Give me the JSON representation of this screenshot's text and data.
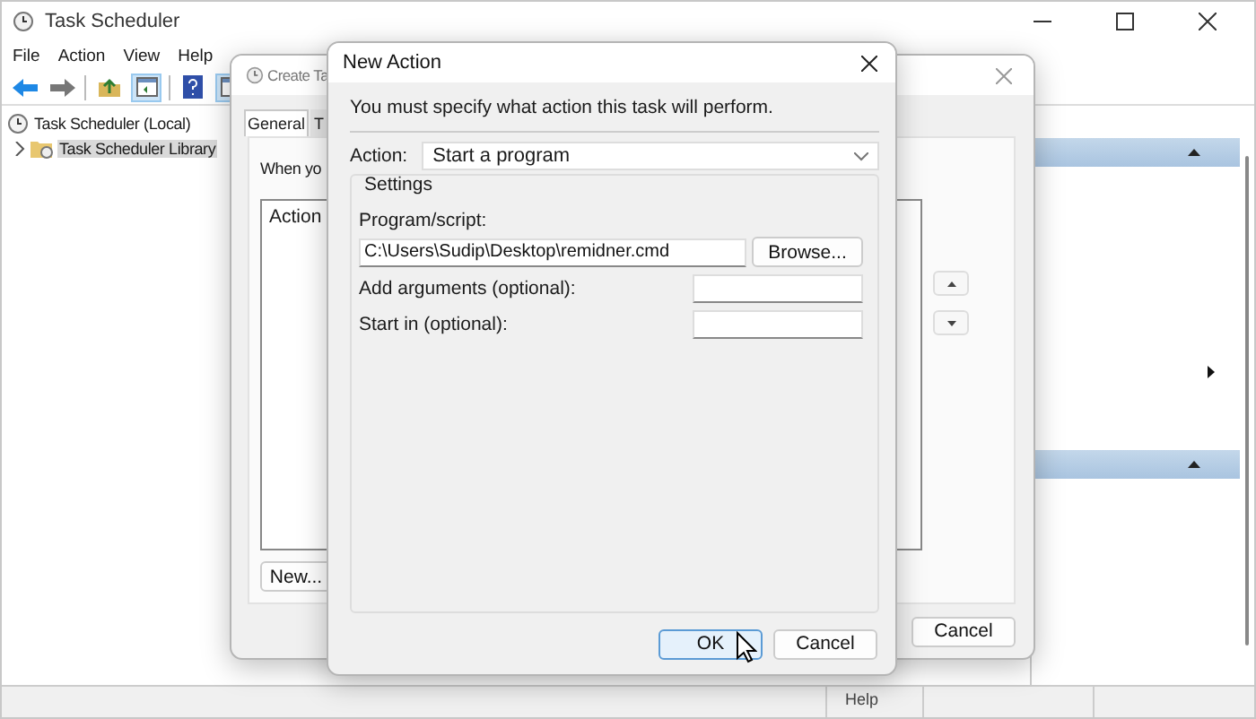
{
  "main_window": {
    "title": "Task Scheduler",
    "menu": [
      "File",
      "Action",
      "View",
      "Help"
    ],
    "tree": [
      {
        "label": "Task Scheduler (Local)",
        "selected": false,
        "children": [
          {
            "label": "Task Scheduler Library",
            "selected": true,
            "expanded": false
          }
        ]
      }
    ],
    "actions_pane": {
      "sections": [
        {
          "expanded": true,
          "rows": [
            {
              "submenu": false
            },
            {
              "submenu": false
            },
            {
              "submenu": false
            },
            {
              "submenu": false
            },
            {
              "submenu": false
            },
            {
              "submenu": false
            },
            {
              "submenu": true
            },
            {
              "submenu": false
            },
            {
              "submenu": false
            }
          ]
        },
        {
          "expanded": true,
          "rows": [
            {
              "submenu": false
            },
            {
              "submenu": false
            },
            {
              "submenu": false
            },
            {
              "submenu": false
            },
            {
              "submenu": false
            },
            {
              "submenu": false
            }
          ]
        }
      ]
    },
    "pane_text": "Help"
  },
  "create_task": {
    "title": "Create Ta",
    "tabs": [
      {
        "label": "General",
        "selected": true
      },
      {
        "label": "T",
        "selected": false
      }
    ],
    "intro": "When yo",
    "list_header": "Action",
    "new_button": "New...",
    "cancel_button": "Cancel"
  },
  "new_action": {
    "title": "New Action",
    "instruction": "You must specify what action this task will perform.",
    "action_label": "Action:",
    "action_value": "Start a program",
    "settings_label": "Settings",
    "fields": [
      {
        "kind": "wide",
        "label": "Program/script:",
        "value": "C:\\Users\\Sudip\\Desktop\\remidner.cmd",
        "button": "Browse..."
      },
      {
        "kind": "inline",
        "label": "Add arguments (optional):"
      },
      {
        "kind": "inline",
        "label": "Start in (optional):"
      }
    ],
    "buttons": [
      {
        "label": "OK",
        "default": true
      },
      {
        "label": "Cancel",
        "default": false
      }
    ]
  }
}
